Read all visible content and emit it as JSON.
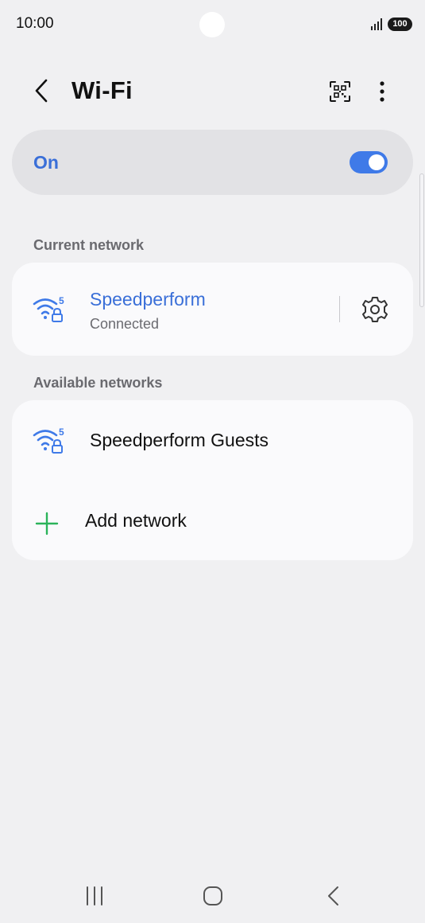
{
  "status_bar": {
    "time": "10:00",
    "battery": "100"
  },
  "header": {
    "title": "Wi-Fi"
  },
  "wifi_toggle": {
    "label": "On",
    "enabled": true
  },
  "current_network": {
    "section_label": "Current network",
    "name": "Speedperform",
    "status": "Connected"
  },
  "available_networks": {
    "section_label": "Available networks",
    "items": [
      {
        "name": "Speedperform Guests"
      }
    ],
    "add_label": "Add network"
  },
  "colors": {
    "accent": "#3f7ae8",
    "add_green": "#2bb35a",
    "background": "#f0f0f2",
    "card": "#fafafc"
  },
  "icons": [
    "signal-icon",
    "back-icon",
    "qr-scan-icon",
    "more-vert-icon",
    "wifi-5ghz-lock-icon",
    "gear-icon",
    "plus-icon",
    "recents-icon",
    "home-icon",
    "nav-back-icon"
  ]
}
